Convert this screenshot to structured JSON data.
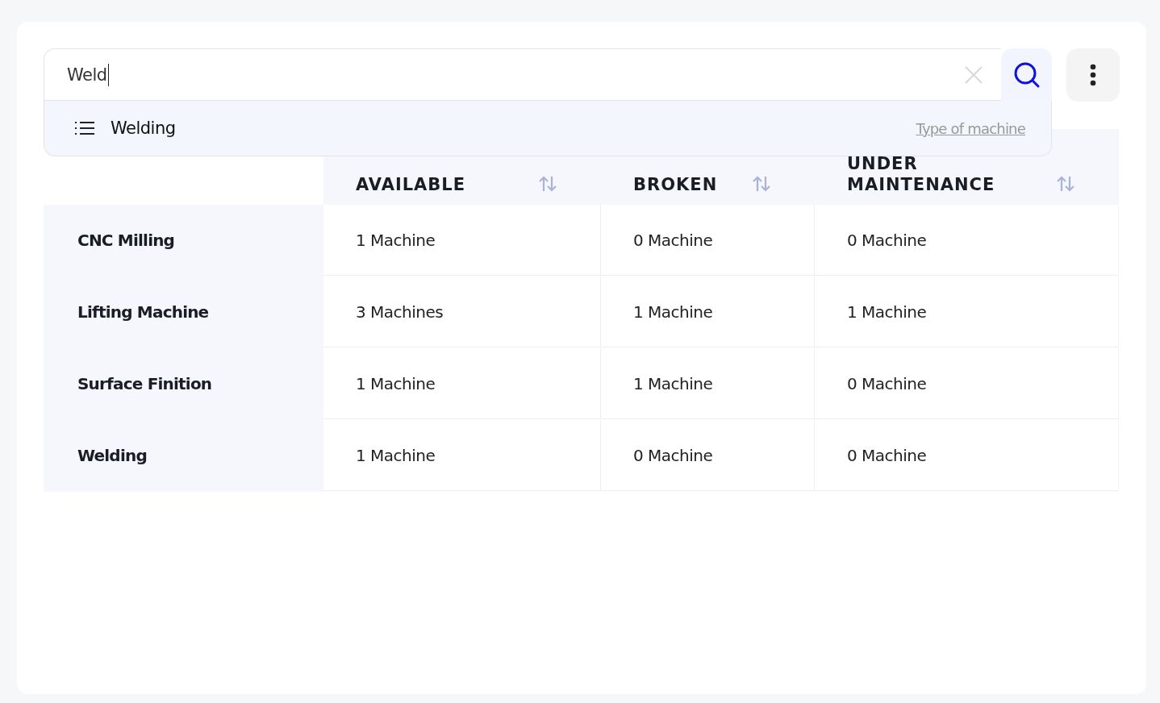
{
  "search": {
    "value": "Weld",
    "suggestions": [
      {
        "label": "Welding",
        "category": "Type of machine"
      }
    ]
  },
  "table": {
    "columns": [
      {
        "label": "AVAILABLE"
      },
      {
        "label": "BROKEN"
      },
      {
        "label": "UNDER MAINTENANCE"
      }
    ],
    "rows": [
      {
        "name": "CNC Milling",
        "cells": [
          "1 Machine",
          "0 Machine",
          "0 Machine"
        ]
      },
      {
        "name": "Lifting Machine",
        "cells": [
          "3 Machines",
          "1 Machine",
          "1 Machine"
        ]
      },
      {
        "name": "Surface Finition",
        "cells": [
          "1 Machine",
          "1 Machine",
          "0 Machine"
        ]
      },
      {
        "name": "Welding",
        "cells": [
          "1 Machine",
          "0 Machine",
          "0 Machine"
        ]
      }
    ]
  }
}
